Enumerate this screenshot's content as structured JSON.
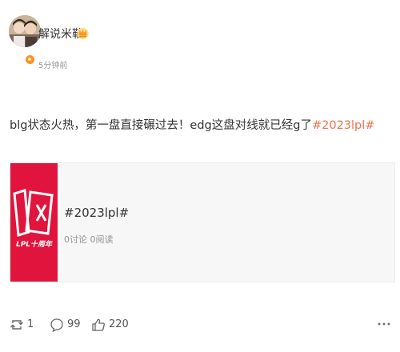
{
  "author": {
    "name": "解说米勒",
    "time": "5分钟前"
  },
  "post": {
    "text": "blg状态火热，第一盘直接碾过去！edg这盘对线就已经g了",
    "hashtag": "#2023lpl#"
  },
  "card": {
    "title": "#2023lpl#",
    "stats": "0讨论 0阅读",
    "thumb_text": "LPL十周年",
    "thumb_logo": "10"
  },
  "actions": {
    "repost_count": "1",
    "comment_count": "99",
    "like_count": "220"
  },
  "icons": {
    "level": "crown-badge-icon",
    "repost": "repost-icon",
    "comment": "comment-icon",
    "like": "thumbs-up-icon",
    "more": "more-dots-icon"
  },
  "colors": {
    "hashtag": "#eb7350",
    "thumb_bg": "#e0143c",
    "meta_text": "#939393"
  }
}
